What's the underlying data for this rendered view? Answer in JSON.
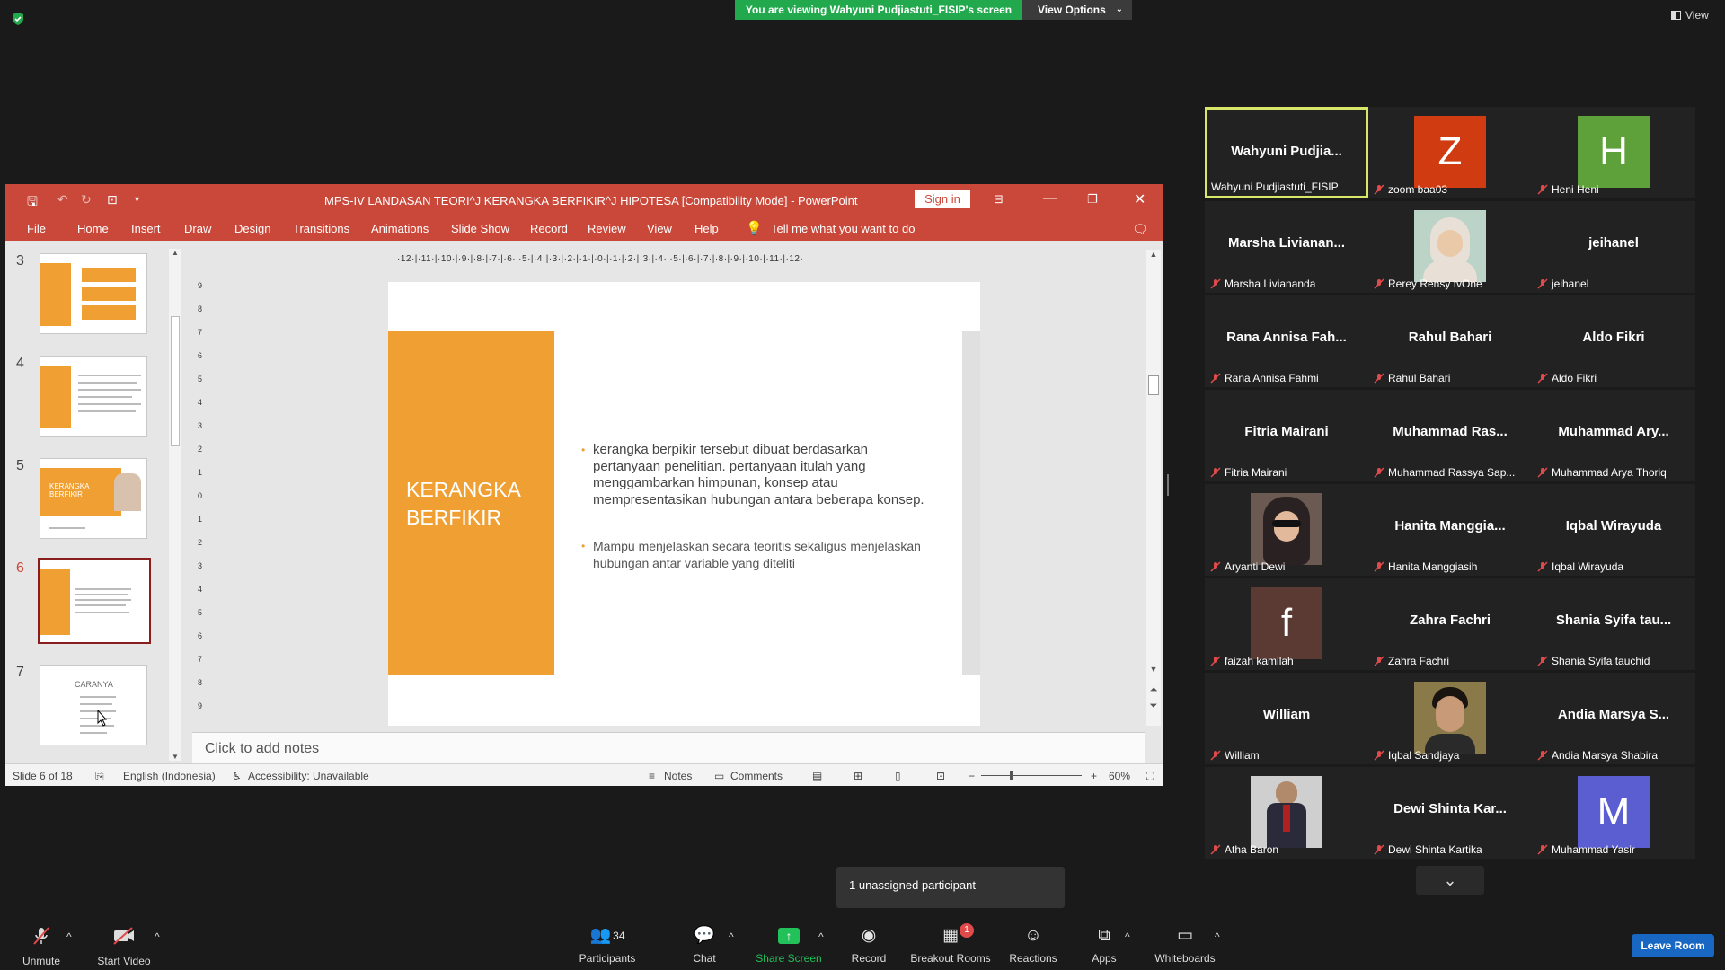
{
  "banner": {
    "viewing_text": "You are viewing Wahyuni Pudjiastuti_FISIP's screen",
    "view_options_label": "View Options",
    "view_label": "View"
  },
  "powerpoint": {
    "title": "MPS-IV LANDASAN TEORI^J KERANGKA BERFIKIR^J HIPOTESA [Compatibility Mode]  -  PowerPoint",
    "sign_in": "Sign in",
    "menu": [
      "File",
      "Home",
      "Insert",
      "Draw",
      "Design",
      "Transitions",
      "Animations",
      "Slide Show",
      "Record",
      "Review",
      "View",
      "Help",
      "Tell me what you want to do"
    ],
    "thumbnails": [
      {
        "number": "3"
      },
      {
        "number": "4"
      },
      {
        "number": "5",
        "text": "KERANGKA BERFIKIR"
      },
      {
        "number": "6"
      },
      {
        "number": "7",
        "text": "CARANYA"
      }
    ],
    "ruler_text": "·12·|·11·|·10·|·9·|·8·|·7·|·6·|·5·|·4·|·3·|·2·|·1·|·0·|·1·|·2·|·3·|·4·|·5·|·6·|·7·|·8·|·9·|·10·|·11·|·12·",
    "vruler": [
      "9",
      "8",
      "7",
      "6",
      "5",
      "4",
      "3",
      "2",
      "1",
      "0",
      "1",
      "2",
      "3",
      "4",
      "5",
      "6",
      "7",
      "8",
      "9"
    ],
    "slide": {
      "title_line1": "KERANGKA",
      "title_line2": "BERFIKIR",
      "bullet1": "kerangka berpikir tersebut dibuat berdasarkan pertanyaan penelitian. pertanyaan itulah yang menggambarkan himpunan, konsep atau mempresentasikan hubungan antara beberapa konsep.",
      "bullet2": "Mampu menjelaskan secara teoritis sekaligus menjelaskan hubungan antar variable yang diteliti"
    },
    "notes_placeholder": "Click to add notes",
    "status": {
      "slide_info": "Slide 6 of 18",
      "language": "English (Indonesia)",
      "accessibility": "Accessibility: Unavailable",
      "notes": "Notes",
      "comments": "Comments",
      "zoom": "60%"
    }
  },
  "gallery": [
    {
      "display": "Wahyuni  Pudjia...",
      "label": "Wahyuni Pudjiastuti_FISIP",
      "active": true,
      "muted": false
    },
    {
      "display": "",
      "avatar_letter": "Z",
      "avatar_color": "#d03b12",
      "label": "zoom baa03"
    },
    {
      "display": "",
      "avatar_letter": "H",
      "avatar_color": "#5ea13a",
      "label": "Heni Heni"
    },
    {
      "display": "Marsha  Livianan...",
      "label": "Marsha Liviananda"
    },
    {
      "display": "",
      "photo": true,
      "label": "Rerey Rensy tvOne"
    },
    {
      "display": "jeihanel",
      "label": "jeihanel"
    },
    {
      "display": "Rana Annisa Fah...",
      "label": "Rana Annisa Fahmi"
    },
    {
      "display": "Rahul Bahari",
      "label": "Rahul Bahari"
    },
    {
      "display": "Aldo Fikri",
      "label": "Aldo Fikri"
    },
    {
      "display": "Fitria Mairani",
      "label": "Fitria Mairani"
    },
    {
      "display": "Muhammad  Ras...",
      "label": "Muhammad Rassya Sap..."
    },
    {
      "display": "Muhammad  Ary...",
      "label": "Muhammad Arya Thoriq"
    },
    {
      "display": "",
      "photo": true,
      "label": "Aryanti Dewi"
    },
    {
      "display": "Hanita  Manggia...",
      "label": "Hanita Manggiasih"
    },
    {
      "display": "Iqbal Wirayuda",
      "label": "Iqbal Wirayuda"
    },
    {
      "display": "",
      "avatar_letter": "f",
      "avatar_color": "#5a3a32",
      "label": "faizah kamilah"
    },
    {
      "display": "Zahra Fachri",
      "label": "Zahra Fachri"
    },
    {
      "display": "Shania  Syifa  tau...",
      "label": "Shania Syifa tauchid"
    },
    {
      "display": "William",
      "label": "William"
    },
    {
      "display": "",
      "photo": true,
      "label": "Iqbal Sandjaya"
    },
    {
      "display": "Andia  Marsya  S...",
      "label": "Andia Marsya Shabira"
    },
    {
      "display": "",
      "photo": true,
      "label": "Atha Baron"
    },
    {
      "display": "Dewi  Shinta  Kar...",
      "label": "Dewi Shinta Kartika"
    },
    {
      "display": "",
      "avatar_letter": "M",
      "avatar_color": "#5a5ed0",
      "label": "Muhammad Yasir"
    }
  ],
  "unassigned_text": "1 unassigned participant",
  "toolbar": {
    "unmute": "Unmute",
    "start_video": "Start Video",
    "participants": "Participants",
    "participants_count": "34",
    "chat": "Chat",
    "share_screen": "Share Screen",
    "record": "Record",
    "breakout_rooms": "Breakout Rooms",
    "breakout_badge": "1",
    "reactions": "Reactions",
    "apps": "Apps",
    "whiteboards": "Whiteboards",
    "leave_room": "Leave Room"
  },
  "colors": {
    "ppt_accent": "#c9483a",
    "slide_orange": "#f0a032",
    "share_green": "#23a94d",
    "leave_blue": "#1867c2",
    "active_speaker": "#d8e66a"
  }
}
